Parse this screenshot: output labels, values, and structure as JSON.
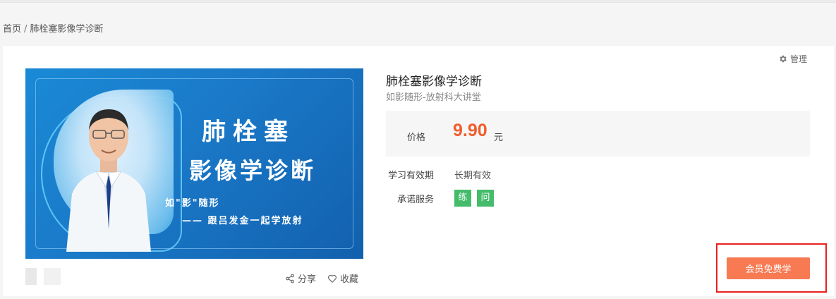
{
  "breadcrumb": {
    "home": "首页",
    "separator": "/",
    "current": "肺栓塞影像学诊断"
  },
  "toolbar": {
    "manage_label": "管理",
    "manage_icon": "gear-icon"
  },
  "cover": {
    "title_line1": "肺栓塞",
    "title_line2": "影像学诊断",
    "subtitle_line1": "如\"影\"随形",
    "subtitle_line2": "—— 跟吕发金一起学放射"
  },
  "actions": {
    "share_label": "分享",
    "share_icon": "share-icon",
    "favorite_label": "收藏",
    "favorite_icon": "heart-icon"
  },
  "course": {
    "title": "肺栓塞影像学诊断",
    "series": "如影随形-放射科大讲堂"
  },
  "price": {
    "label": "价格",
    "value": "9.90",
    "unit": "元"
  },
  "validity": {
    "label": "学习有效期",
    "value": "长期有效"
  },
  "services": {
    "label": "承诺服务",
    "badges": [
      "练",
      "问"
    ]
  },
  "cta": {
    "label": "会员免费学"
  },
  "colors": {
    "price": "#f25d2d",
    "cta_bg": "#f77a53",
    "badge_bg": "#44bc6b",
    "highlight_border": "#e8201e",
    "cover_bg": "#1a79c8"
  }
}
